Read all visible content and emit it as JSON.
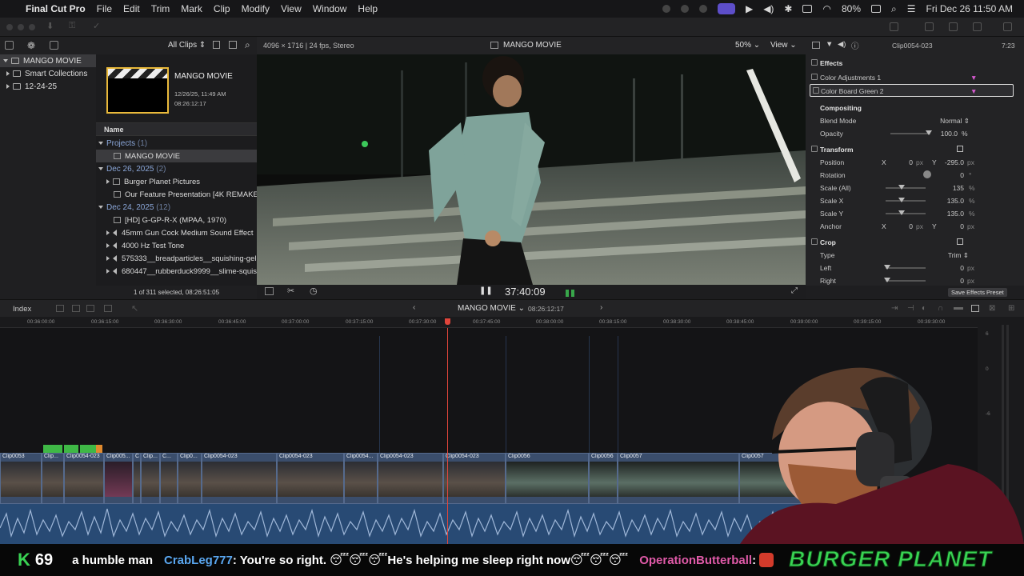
{
  "menubar": {
    "app_name": "Final Cut Pro",
    "items": [
      "File",
      "Edit",
      "Trim",
      "Mark",
      "Clip",
      "Modify",
      "View",
      "Window",
      "Help"
    ],
    "battery": "80%",
    "datetime": "Fri Dec 26  11:50 AM"
  },
  "library": {
    "items": [
      {
        "label": "MANGO MOVIE",
        "selected": true
      },
      {
        "label": "Smart Collections",
        "selected": false
      },
      {
        "label": "12-24-25",
        "selected": false
      }
    ]
  },
  "browser": {
    "filter": "All Clips",
    "project": {
      "title": "MANGO MOVIE",
      "date": "12/26/25, 11:49 AM",
      "duration": "08:26:12:17"
    },
    "column_name": "Name",
    "rows": [
      {
        "kind": "group",
        "label": "Projects",
        "count": "(1)"
      },
      {
        "kind": "item",
        "label": "MANGO MOVIE",
        "icon": "film-icon",
        "selected": true
      },
      {
        "kind": "group",
        "label": "Dec 26, 2025",
        "count": "(2)"
      },
      {
        "kind": "item",
        "label": "Burger Planet Pictures",
        "icon": "folder-icon",
        "disclosure": true
      },
      {
        "kind": "item",
        "label": "Our Feature Presentation [4K REMAKE]",
        "icon": "film-icon"
      },
      {
        "kind": "group",
        "label": "Dec 24, 2025",
        "count": "(12)"
      },
      {
        "kind": "item",
        "label": "[HD] G-GP-R-X (MPAA, 1970)",
        "icon": "film-icon"
      },
      {
        "kind": "item",
        "label": "45mm Gun Cock Medium Sound Effect",
        "icon": "speaker-icon",
        "disclosure": true
      },
      {
        "kind": "item",
        "label": "4000 Hz Test Tone",
        "icon": "speaker-icon",
        "disclosure": true
      },
      {
        "kind": "item",
        "label": "575333__breadparticles__squishing-gel",
        "icon": "speaker-icon",
        "disclosure": true
      },
      {
        "kind": "item",
        "label": "680447__rubberduck9999__slime-squis",
        "icon": "speaker-icon",
        "disclosure": true
      }
    ],
    "status": "1 of 311 selected, 08:26:51:05"
  },
  "viewer": {
    "format": "4096 × 1716 | 24 fps, Stereo",
    "title": "MANGO MOVIE",
    "zoom": "50%",
    "view_label": "View",
    "timecode": "37:40:09"
  },
  "inspector": {
    "clip_name": "Clip0054-023",
    "duration": "7:23",
    "effects_label": "Effects",
    "effects": [
      {
        "label": "Color Adjustments 1",
        "selected": false
      },
      {
        "label": "Color Board Green 2",
        "selected": true
      }
    ],
    "compositing": {
      "title": "Compositing",
      "blend_label": "Blend Mode",
      "blend_value": "Normal",
      "opacity_label": "Opacity",
      "opacity_value": "100.0",
      "opacity_unit": "%"
    },
    "transform": {
      "title": "Transform",
      "position_label": "Position",
      "pos_x_label": "X",
      "pos_x": "0",
      "pos_y_label": "Y",
      "pos_y": "-295.0",
      "px": "px",
      "rotation_label": "Rotation",
      "rotation": "0",
      "deg": "°",
      "scale_all_label": "Scale (All)",
      "scale_all": "135",
      "pct": "%",
      "scale_x_label": "Scale X",
      "scale_x": "135.0",
      "scale_y_label": "Scale Y",
      "scale_y": "135.0",
      "anchor_label": "Anchor",
      "anchor_x_label": "X",
      "anchor_x": "0",
      "anchor_y_label": "Y",
      "anchor_y": "0"
    },
    "crop": {
      "title": "Crop",
      "type_label": "Type",
      "type_value": "Trim",
      "left_label": "Left",
      "left": "0",
      "right_label": "Right",
      "right": "0"
    },
    "save_preset": "Save Effects Preset"
  },
  "timeline": {
    "index_label": "Index",
    "project_name": "MANGO MOVIE",
    "project_duration": "08:26:12:17",
    "ruler": [
      "00:36:00:00",
      "00:36:15:00",
      "00:36:30:00",
      "00:36:45:00",
      "00:37:00:00",
      "00:37:15:00",
      "00:37:30:00",
      "00:37:45:00",
      "00:38:00:00",
      "00:38:15:00",
      "00:38:30:00",
      "00:38:45:00",
      "00:39:00:00",
      "00:39:15:00",
      "00:39:30:00"
    ],
    "clips": [
      {
        "name": "Clip0053"
      },
      {
        "name": "Clip..."
      },
      {
        "name": "Clip0054-023"
      },
      {
        "name": "Clip005..."
      },
      {
        "name": "C"
      },
      {
        "name": "Clip..."
      },
      {
        "name": "C..."
      },
      {
        "name": "Clip0..."
      },
      {
        "name": "Clip0054-023"
      },
      {
        "name": "Clip0054-023"
      },
      {
        "name": "Clip0054..."
      },
      {
        "name": "Clip0054-023"
      },
      {
        "name": "Clip0054-023"
      },
      {
        "name": "Clip0056"
      },
      {
        "name": "Clip0056"
      },
      {
        "name": "Clip0057"
      },
      {
        "name": "Clip0057"
      }
    ],
    "meter_labels": [
      "6",
      "0",
      "-6"
    ]
  },
  "chat": {
    "k_count": "69",
    "text1": "a humble man",
    "user1": "CrabLeg777",
    "msg1": ": You're so right. 😴😴😴He's helping me sleep right now😴😴😴",
    "user2": "OperationButterball",
    "msg2": " : ",
    "brand": "BURGER PLANET"
  },
  "colors": {
    "accent_yellow": "#e9b93b",
    "playhead": "#e0453b",
    "clip_blue": "#3a4d6b",
    "audio_blue": "#284a74",
    "chat_user1": "#5aa7f0",
    "chat_user2": "#e05aa8",
    "brand_green": "#39d353"
  }
}
